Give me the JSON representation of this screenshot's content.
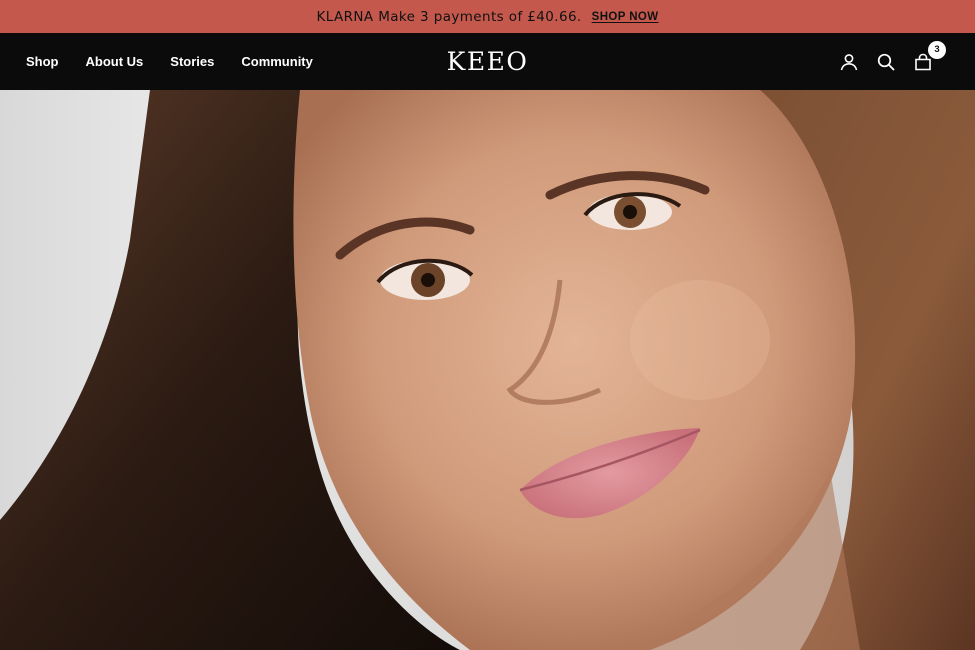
{
  "announcement": {
    "message": "KLARNA Make 3 payments of £40.66.",
    "cta": "SHOP NOW"
  },
  "header": {
    "nav": [
      {
        "label": "Shop"
      },
      {
        "label": "About Us"
      },
      {
        "label": "Stories"
      },
      {
        "label": "Community"
      }
    ],
    "logo": "KEEO",
    "icons": [
      "account-icon",
      "search-icon",
      "cart-icon"
    ],
    "cart_count": "3"
  },
  "colors": {
    "announcement_bg": "#c4584c",
    "header_bg": "#0b0b0b",
    "nav_text": "#ffffff"
  }
}
